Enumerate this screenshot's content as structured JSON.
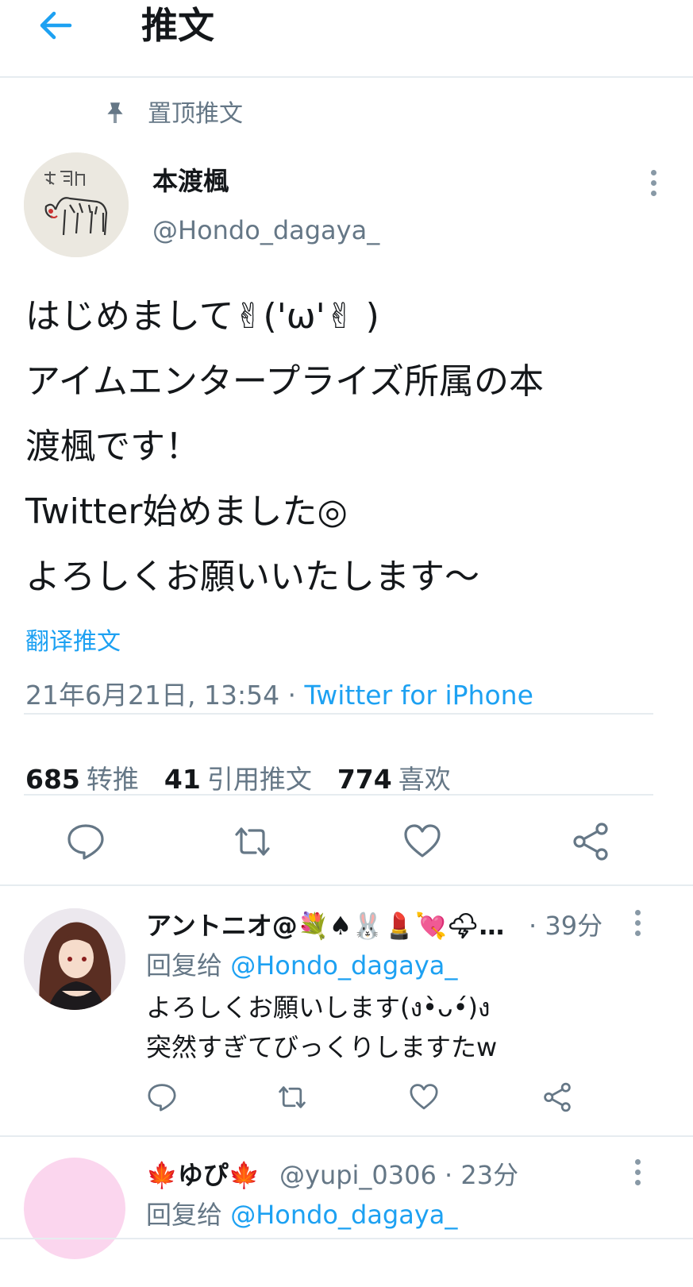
{
  "header": {
    "title": "推文",
    "back_icon": "arrow-left-icon"
  },
  "pinned_label": "置顶推文",
  "tweet": {
    "author_name": "本渡楓",
    "author_handle": "@Hondo_dagaya_",
    "text": "はじめまして✌('ω'✌ )\nアイムエンタープライズ所属の本\n渡楓です！\nTwitter始めました◎\nよろしくお願いいたします〜",
    "translate_label": "翻译推文",
    "date": "21年6月21日, 13:54 · ",
    "source": "Twitter for iPhone",
    "retweets_count": "685",
    "retweets_label": "转推",
    "quotes_count": "41",
    "quotes_label": "引用推文",
    "likes_count": "774",
    "likes_label": "喜欢"
  },
  "replies": [
    {
      "name": "アントニオ@💐♠🐰💄💘🌩…",
      "meta": " · 39分",
      "reply_prefix": "回复给 ",
      "reply_mention": "@Hondo_dagaya_",
      "text": "よろしくお願いします(ง•̀ᴗ•́)ง\n突然すぎてびっくりしますたw"
    },
    {
      "name": "🍁ゆぴ🍁",
      "meta": "@yupi_0306 · 23分",
      "reply_prefix": "回复给 ",
      "reply_mention": "@Hondo_dagaya_"
    }
  ],
  "colors": {
    "accent": "#1da1f2",
    "secondary_text": "#657786",
    "divider": "#e6ecf0"
  }
}
